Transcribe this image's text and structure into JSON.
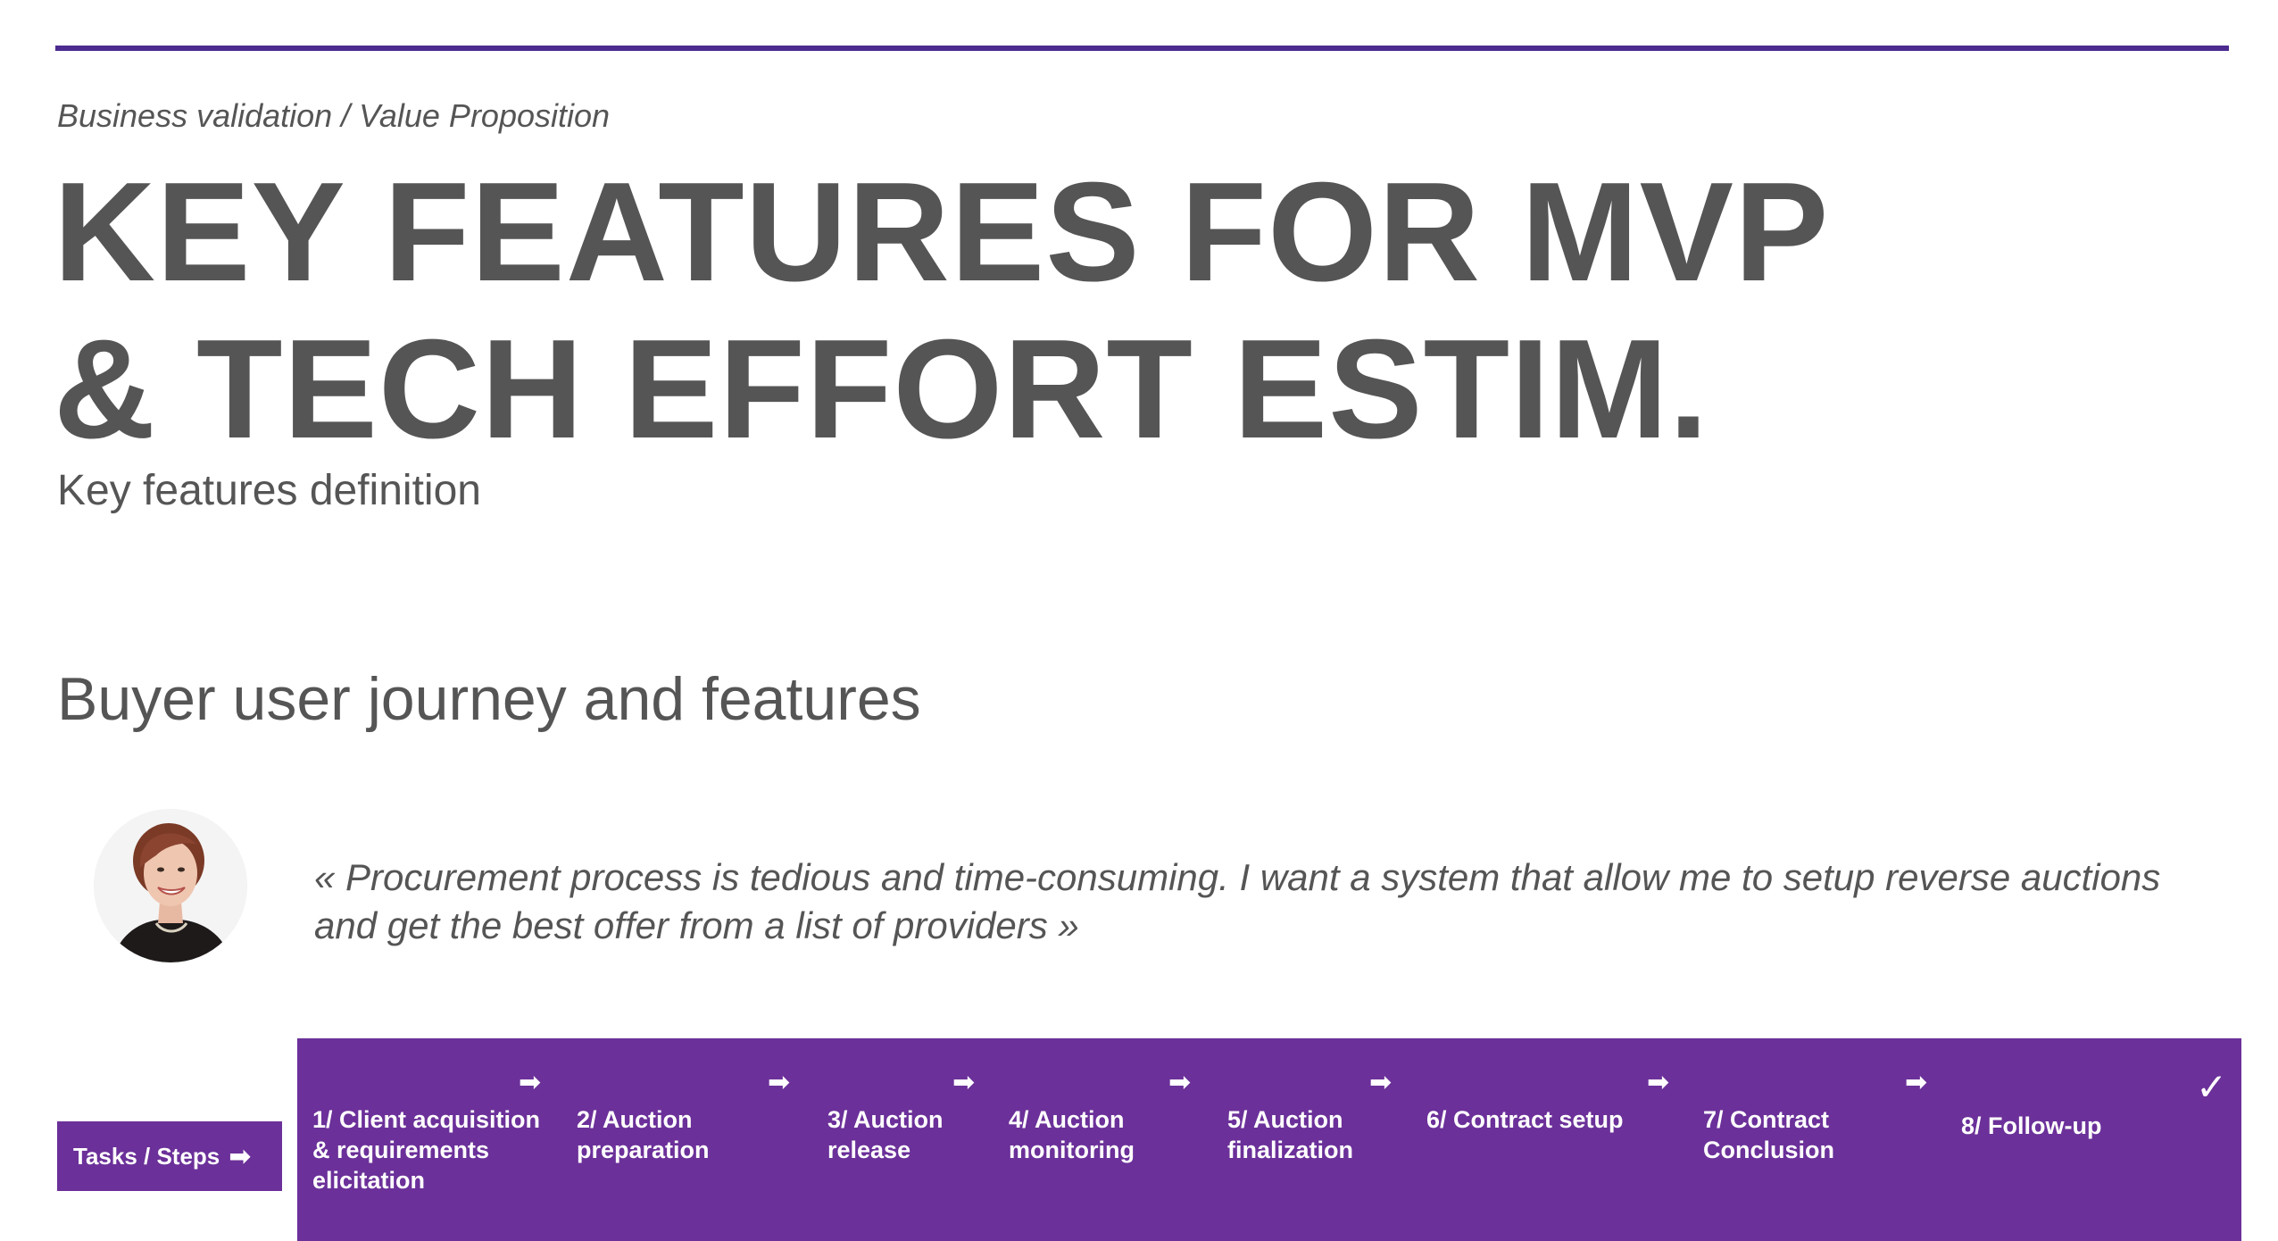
{
  "header": {
    "breadcrumb": "Business validation / Value Proposition",
    "title_line1": "KEY FEATURES FOR MVP",
    "title_line2": "& TECH EFFORT ESTIM.",
    "subtitle": "Key features definition"
  },
  "section": {
    "heading": "Buyer user journey and features"
  },
  "persona": {
    "quote": "« Procurement process is tedious and time-consuming. I want a system that allow me to setup reverse auctions and get the best offer from a list of providers »"
  },
  "journey": {
    "tasks_label": "Tasks / Steps",
    "arrow_glyph": "➡",
    "done_glyph": "✓",
    "steps": [
      {
        "label": "1/ Client acquisition & requirements elicitation"
      },
      {
        "label": "2/ Auction preparation"
      },
      {
        "label": "3/ Auction release"
      },
      {
        "label": "4/ Auction monitoring"
      },
      {
        "label": "5/ Auction finalization"
      },
      {
        "label": "6/ Contract setup"
      },
      {
        "label": "7/ Contract Conclusion"
      },
      {
        "label": "8/ Follow-up"
      }
    ]
  },
  "colors": {
    "accent": "#6b3099",
    "rule": "#4b2b8f",
    "text": "#555555"
  }
}
